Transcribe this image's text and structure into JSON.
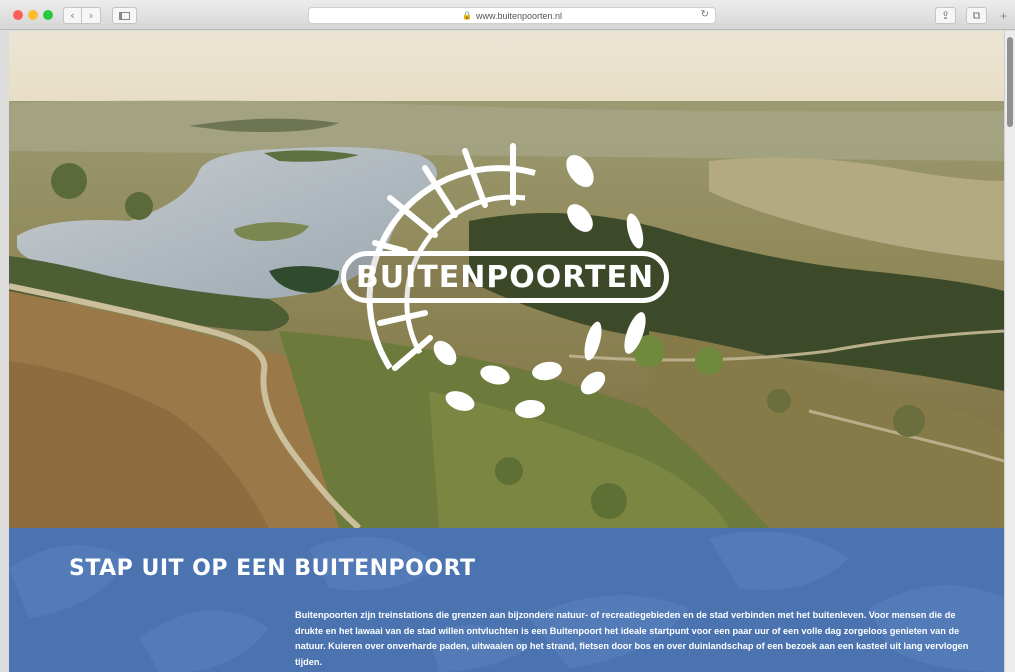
{
  "browser": {
    "url": "www.buitenpoorten.nl",
    "back_icon": "‹",
    "forward_icon": "›",
    "lock_icon": "🔒",
    "reload_icon": "↻",
    "share_icon": "⇪",
    "tabs_icon": "⧉",
    "new_tab_icon": "+"
  },
  "hero": {
    "logo_text": "BUITENPOORTEN"
  },
  "info": {
    "heading": "STAP UIT OP EEN BUITENPOORT",
    "body": "Buitenpoorten zijn treinstations die grenzen aan bijzondere natuur- of recreatiegebieden en de stad verbinden met het buitenleven. Voor mensen die de drukte en het lawaai van de stad willen ontvluchten is een Buitenpoort het ideale startpunt voor een paar uur of een volle dag zorgeloos genieten van de natuur. Kuieren over onverharde paden, uitwaaien op het strand, fietsen door bos en over duinlandschap of een bezoek aan een kasteel uit lang vervlogen tijden."
  },
  "colors": {
    "brand_blue": "#4a73b0",
    "logo_white": "#ffffff"
  }
}
